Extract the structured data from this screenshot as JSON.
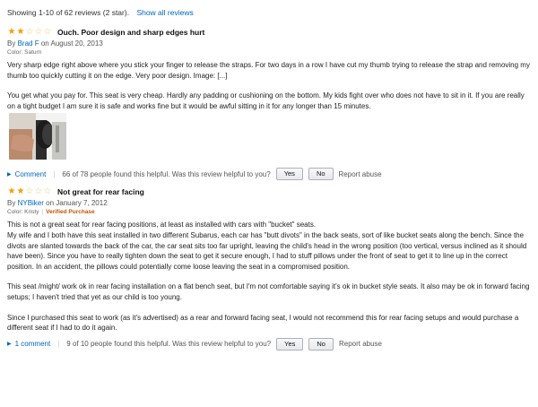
{
  "header": {
    "summary": "Showing 1-10 of 62 reviews (2 star).",
    "show_all": "Show all reviews"
  },
  "reviews": [
    {
      "rating": 2,
      "title": "Ouch. Poor design and sharp edges hurt",
      "by_label": "By",
      "author": "Brad F",
      "date_label": "on August 20, 2013",
      "color": "Color: Saturn",
      "verified": "",
      "paragraphs": [
        "Very sharp edge right above where you stick your finger to release the straps. For two days in a row I have cut my thumb trying to release the strap and removing my thumb too quickly cutting it on the edge. Very poor design. Image: [...]",
        "You get what you pay for. This seat is very cheap. Hardly any padding or cushioning on the bottom. My kids fight over who does not have to sit in it. If you are really on a tight budget I am sure it is safe and works fine but it would be awful sitting in it for any longer than 15 minutes."
      ],
      "comment": "Comment",
      "helpful": "66 of 78 people found this helpful. Was this review helpful to you?",
      "yes": "Yes",
      "no": "No",
      "abuse": "Report abuse"
    },
    {
      "rating": 2,
      "title": "Not great for rear facing",
      "by_label": "By",
      "author": "NYBiker",
      "date_label": "on January 7, 2012",
      "color": "Color: Kristy",
      "verified": "Verified Purchase",
      "paragraphs": [
        "This is not a great seat for rear facing positions, at least as installed with cars with \"bucket\" seats.\nMy wife and I both have this seat installed in two different Subarus, each car has \"butt divots\" in the back seats, sort of like bucket seats along the bench. Since the divots are slanted towards the back of the car, the car seat sits too far upright, leaving the child's head in the wrong position (too vertical, versus inclined as it should have been). Since you have to really tighten down the seat to get it secure enough, I had to stuff pillows under the front of seat to get it to line up in the correct position. In an accident, the pillows could potentially come loose leaving the seat in a compromised position.",
        "This seat /might/ work ok in rear facing installation on a flat bench seat, but I'm not comfortable saying it's ok in bucket style seats. It also may be ok in forward facing setups; I haven't tried that yet as our child is too young.",
        "Since I purchased this seat to work (as it's advertised) as a rear and forward facing seat, I would not recommend this for rear facing setups and would purchase a different seat if I had to do it again."
      ],
      "comment": "1 comment",
      "helpful": "9 of 10 people found this helpful. Was this review helpful to you?",
      "yes": "Yes",
      "no": "No",
      "abuse": "Report abuse"
    }
  ],
  "icons": {
    "star_filled": "star-filled-icon",
    "star_empty": "star-empty-icon",
    "expand": "triangle-right-icon"
  },
  "colors": {
    "link": "#0066c0",
    "star": "#f0a000",
    "verified": "#c45500"
  }
}
